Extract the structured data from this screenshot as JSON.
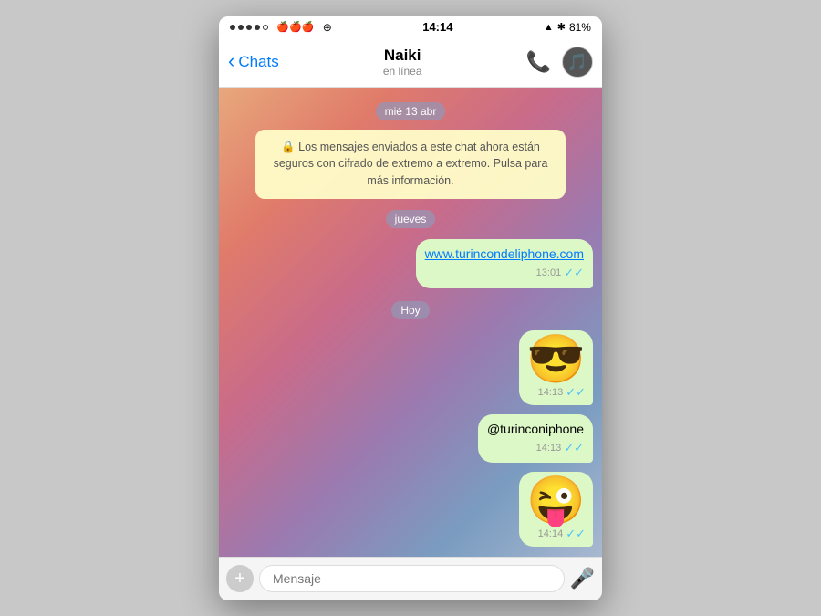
{
  "status_bar": {
    "dots": [
      "filled",
      "filled",
      "filled",
      "filled",
      "empty"
    ],
    "apple_icons": "🍎 🍎 🍎",
    "time": "14:14",
    "wifi": "wifi",
    "location": "▲",
    "bluetooth": "✱",
    "battery": "81%"
  },
  "nav": {
    "back_label": "Chats",
    "contact_name": "Naiki",
    "contact_status": "en línea",
    "phone_icon": "📞",
    "avatar_emoji": "🎵"
  },
  "chat": {
    "date_badge_1": "mié 13 abr",
    "security_notice": "🔒 Los mensajes enviados a este chat ahora están seguros con cifrado de extremo a extremo. Pulsa para más información.",
    "date_badge_2": "jueves",
    "link_message": "www.turincondeliphone.com",
    "link_time": "13:01",
    "date_badge_3": "Hoy",
    "msg1_emoji": "😎",
    "msg1_time": "14:13",
    "msg2_text": "@turinconiphone",
    "msg2_time": "14:13",
    "msg3_emoji": "😜",
    "msg3_time": "14:14"
  },
  "input": {
    "placeholder": "Mensaje"
  }
}
